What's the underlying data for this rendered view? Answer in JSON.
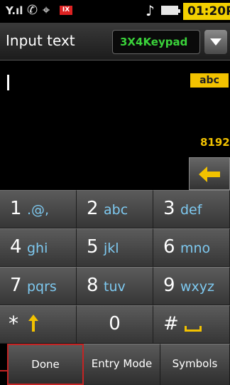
{
  "status_bar": {
    "time": "01:20P",
    "sd_badge": "IX",
    "time_bg": "#f3d000"
  },
  "header": {
    "title": "Input text",
    "entry_type": "3X4Keypad"
  },
  "text_area": {
    "value": "",
    "case_mode": "abc",
    "char_remaining": "8192"
  },
  "keypad": {
    "rows": [
      [
        {
          "num": "1",
          "letters": ".@,"
        },
        {
          "num": "2",
          "letters": "abc"
        },
        {
          "num": "3",
          "letters": "def"
        }
      ],
      [
        {
          "num": "4",
          "letters": "ghi"
        },
        {
          "num": "5",
          "letters": "jkl"
        },
        {
          "num": "6",
          "letters": "mno"
        }
      ],
      [
        {
          "num": "7",
          "letters": "pqrs"
        },
        {
          "num": "8",
          "letters": "tuv"
        },
        {
          "num": "9",
          "letters": "wxyz"
        }
      ]
    ],
    "bottom": {
      "star": "*",
      "zero": "0",
      "hash": "#"
    }
  },
  "softkeys": {
    "done": "Done",
    "entry_mode": "Entry Mode",
    "symbols": "Symbols"
  },
  "colors": {
    "accent_yellow": "#f2c200",
    "letters_blue": "#7ec9f0",
    "mode_green": "#3ad23a",
    "highlight_red": "#c42424"
  }
}
